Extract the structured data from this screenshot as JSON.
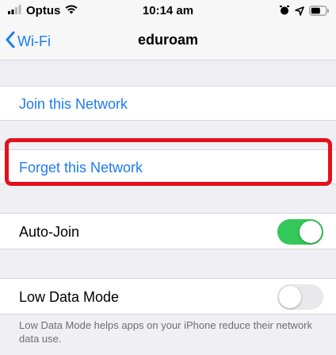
{
  "status_bar": {
    "carrier": "Optus",
    "time": "10:14 am",
    "icons": [
      "signal-icon",
      "wifi-icon",
      "alarm-icon",
      "location-icon",
      "battery-icon"
    ]
  },
  "nav": {
    "back_label": "Wi-Fi",
    "title": "eduroam"
  },
  "rows": {
    "join": "Join this Network",
    "forget": "Forget this Network",
    "auto_join": "Auto-Join",
    "low_data": "Low Data Mode"
  },
  "toggles": {
    "auto_join_on": true,
    "low_data_on": false
  },
  "footnote": "Low Data Mode helps apps on your iPhone reduce their network data use.",
  "colors": {
    "accent": "#1f7cf0",
    "toggle_on": "#34c759",
    "highlight": "#e4101c",
    "background": "#efeff3"
  }
}
